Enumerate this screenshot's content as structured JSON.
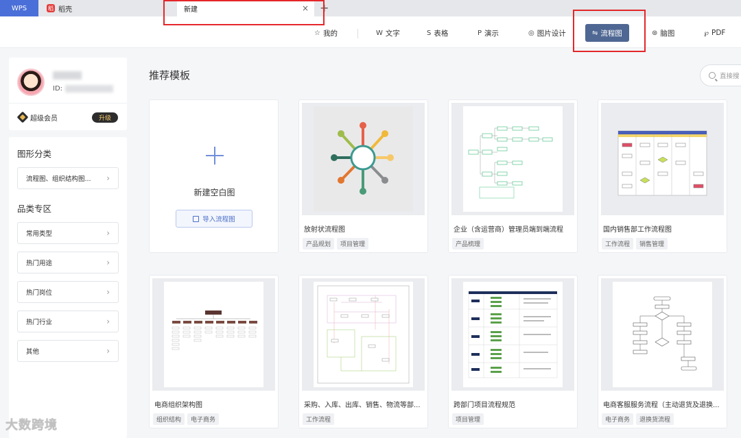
{
  "tabs": {
    "wps": "WPS",
    "daoke": "稻壳",
    "daoke_icon": "稻",
    "new": "新建",
    "close": "×",
    "add": "+"
  },
  "nav": {
    "items": [
      {
        "icon": "☆",
        "label": "我的"
      },
      {
        "icon": "W",
        "label": "文字"
      },
      {
        "icon": "S",
        "label": "表格"
      },
      {
        "icon": "P",
        "label": "演示"
      },
      {
        "icon": "◎",
        "label": "图片设计"
      },
      {
        "icon": "⇋",
        "label": "流程图"
      },
      {
        "icon": "⊛",
        "label": "脑图"
      },
      {
        "icon": "℘",
        "label": "PDF"
      }
    ],
    "active": "流程图"
  },
  "profile": {
    "id_label": "ID:",
    "member": "超级会员",
    "upgrade": "升级"
  },
  "sidebar": {
    "shape_heading": "图形分类",
    "shape_item": "流程图、组织结构图...",
    "category_heading": "品类专区",
    "categories": [
      "常用类型",
      "热门用途",
      "热门岗位",
      "热门行业",
      "其他"
    ]
  },
  "main": {
    "title": "推荐模板",
    "search_placeholder": "直接搜",
    "blank_label": "新建空白图",
    "import_label": "导入流程图"
  },
  "cards": [
    {
      "title": "放射状流程图",
      "tags": [
        "产品规划",
        "项目管理"
      ]
    },
    {
      "title": "企业（含运营商）管理员端到端流程",
      "tags": [
        "产品梳理"
      ]
    },
    {
      "title": "国内销售部工作流程图",
      "tags": [
        "工作流程",
        "销售管理"
      ]
    },
    {
      "title": "电商组织架构图",
      "tags": [
        "组织结构",
        "电子商务"
      ]
    },
    {
      "title": "采购、入库、出库、销售、物流等部...",
      "tags": [
        "工作流程"
      ]
    },
    {
      "title": "跨部门项目流程规范",
      "tags": [
        "项目管理"
      ]
    },
    {
      "title": "电商客服服务流程（主动退货及退换...",
      "tags": [
        "电子商务",
        "退换货流程"
      ]
    }
  ],
  "watermark": "大数跨境",
  "colors": {
    "accent": "#4f6793",
    "highlight": "#e4262a",
    "wps_tab": "#4a6fd8"
  }
}
